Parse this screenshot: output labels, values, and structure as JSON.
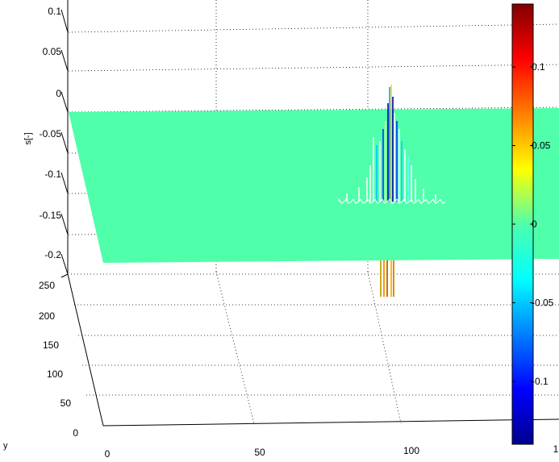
{
  "chart_data": {
    "type": "surface",
    "xlabel": "",
    "ylabel": "y",
    "zlabel": "s[-]",
    "xlim": [
      0,
      150
    ],
    "ylim": [
      0,
      250
    ],
    "zlim": [
      -0.22,
      0.12
    ],
    "x_ticks": [
      "0",
      "50",
      "100",
      "1"
    ],
    "y_ticks": [
      "0",
      "50",
      "100",
      "150",
      "200",
      "250"
    ],
    "z_ticks": [
      "0.1",
      "0.05",
      "0",
      "-0.05",
      "-0.1",
      "-0.15",
      "-0.2"
    ],
    "surface_base_value": 0,
    "surface_base_color": "#4fffaa",
    "grid": true,
    "colorbar": {
      "colormap": "jet",
      "limits": [
        -0.14,
        0.14
      ],
      "ticks": [
        "0.1",
        "0.05",
        "0",
        "-0.05",
        "-0.1"
      ],
      "tick_values": [
        0.1,
        0.05,
        0,
        -0.05,
        -0.1
      ]
    }
  }
}
